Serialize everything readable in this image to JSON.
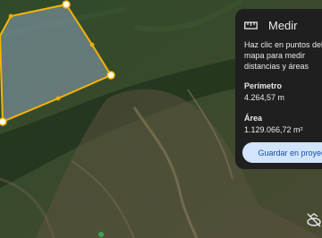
{
  "panel": {
    "title": "Medir",
    "hint": "Haz clic en puntos del mapa para medir distancias y áreas",
    "perimeter_label": "Perímetro",
    "perimeter_value": "4.264,57 m",
    "area_label": "Área",
    "area_value": "1.129.066,72 m²",
    "save_label": "Guardar en proyecto"
  },
  "icons": {
    "ruler": "ruler-icon",
    "bookmark": "bookmark-icon",
    "no-tilt": "tilt-off-icon"
  },
  "colors": {
    "measure_line": "#f5b400",
    "panel_bg": "#1f1f1f",
    "save_button_bg": "#d2e3fc",
    "save_button_text": "#174ea6"
  }
}
